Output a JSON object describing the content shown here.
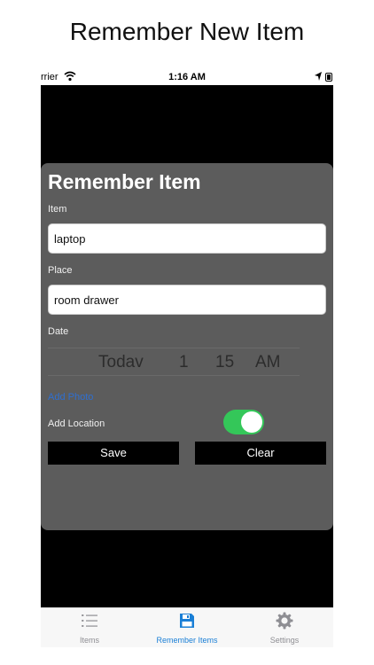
{
  "headline": "Remember New Item",
  "status_bar": {
    "carrier": "rrier",
    "time": "1:16 AM"
  },
  "form": {
    "title": "Remember Item",
    "item_label": "Item",
    "item_value": "laptop",
    "place_label": "Place",
    "place_value": "room drawer",
    "date_label": "Date",
    "date_picker": {
      "day": "Todav",
      "hour": "1",
      "minute": "15",
      "period": "AM"
    },
    "add_photo": "Add Photo",
    "add_location_label": "Add Location",
    "add_location_on": true,
    "save_label": "Save",
    "clear_label": "Clear"
  },
  "tabs": [
    {
      "label": "Items",
      "icon": "list-icon"
    },
    {
      "label": "Remember Items",
      "icon": "save-icon"
    },
    {
      "label": "Settings",
      "icon": "gear-icon"
    }
  ],
  "colors": {
    "accent": "#1a7fd6",
    "toggle_on": "#34c759",
    "card_bg": "#5c5c5c"
  }
}
